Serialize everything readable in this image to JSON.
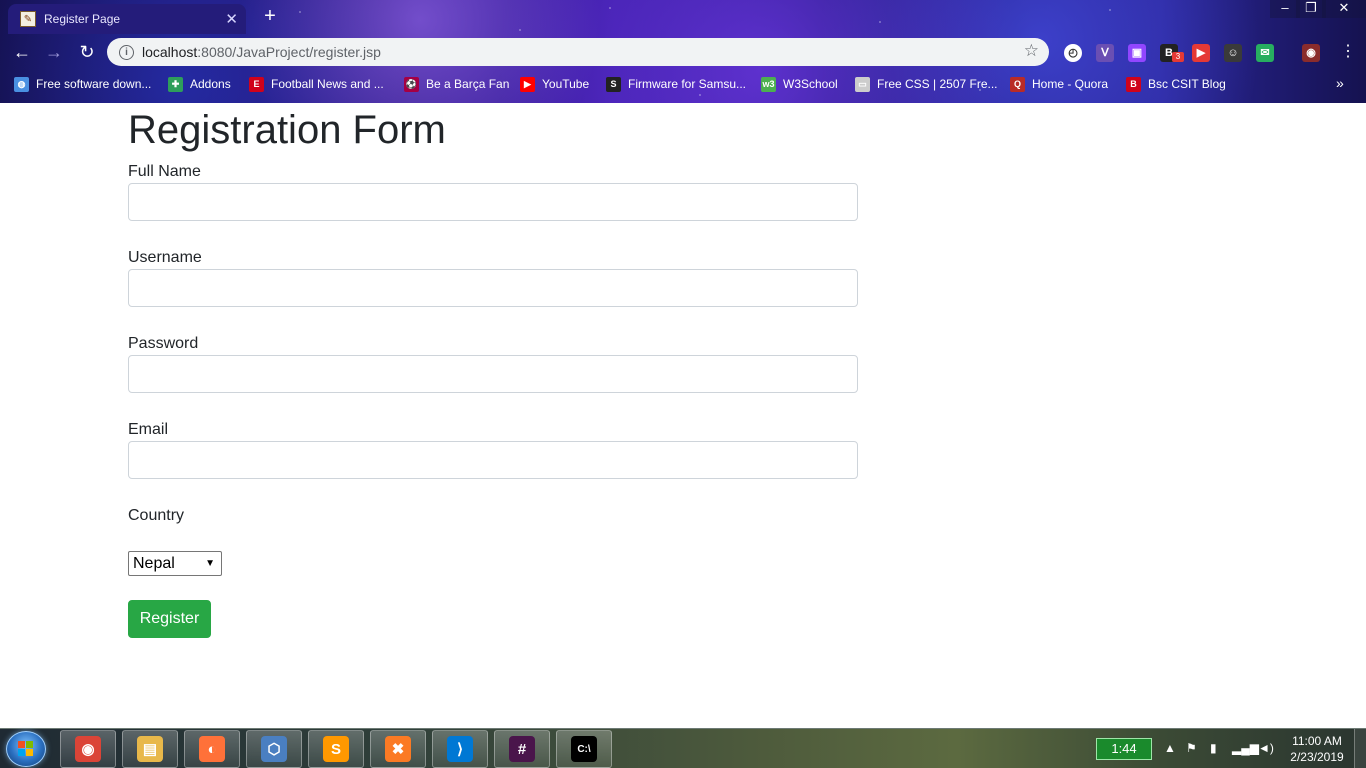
{
  "browser": {
    "tab_title": "Register Page",
    "tab_close": "✕",
    "new_tab": "+",
    "url_host": "localhost",
    "url_rest": ":8080/JavaProject/register.jsp",
    "window_controls": {
      "minimize": "–",
      "maximize": "❐",
      "close": "✕"
    },
    "extensions": [
      {
        "name": "speedometer-icon",
        "color": "#ffffff",
        "glyph": "◴"
      },
      {
        "name": "vs-extension-icon",
        "color": "#6a4fb3",
        "glyph": "ᐯ"
      },
      {
        "name": "twitch-icon",
        "color": "#9146ff",
        "glyph": "▣"
      },
      {
        "name": "b-extension-icon",
        "color": "#222222",
        "glyph": "B"
      },
      {
        "name": "play-extension-icon",
        "color": "#e53935",
        "glyph": "▶"
      },
      {
        "name": "profile-extension-icon",
        "color": "#3a3a3a",
        "glyph": "☺"
      },
      {
        "name": "chat-extension-icon",
        "color": "#27ae60",
        "glyph": "✉"
      },
      {
        "name": "user-avatar-icon",
        "color": "#8a2c2c",
        "glyph": "◉"
      }
    ],
    "extension_badge": "3",
    "bookmarks": [
      {
        "label": "Free software down...",
        "icon": "globe-icon",
        "color": "#4a90e2",
        "glyph": "◍"
      },
      {
        "label": "Addons",
        "icon": "puzzle-icon",
        "color": "#2e9e5b",
        "glyph": "✚"
      },
      {
        "label": "Football News and ...",
        "icon": "espn-icon",
        "color": "#d0021b",
        "glyph": "E"
      },
      {
        "label": "Be a Barça Fan",
        "icon": "barca-icon",
        "color": "#a50044",
        "glyph": "⚽"
      },
      {
        "label": "YouTube",
        "icon": "youtube-icon",
        "color": "#ff0000",
        "glyph": "▶"
      },
      {
        "label": "Firmware for Samsu...",
        "icon": "s-icon",
        "color": "#222222",
        "glyph": "S"
      },
      {
        "label": "W3School",
        "icon": "w3school-icon",
        "color": "#4caf50",
        "glyph": "w3"
      },
      {
        "label": "Free CSS | 2507 Fre...",
        "icon": "css-icon",
        "color": "#cccccc",
        "glyph": "▭"
      },
      {
        "label": "Home - Quora",
        "icon": "quora-icon",
        "color": "#b92b27",
        "glyph": "Q"
      },
      {
        "label": "Bsc CSIT Blog",
        "icon": "blog-icon",
        "color": "#d0021b",
        "glyph": "B"
      }
    ],
    "bookmarks_more": "»"
  },
  "form": {
    "title": "Registration Form",
    "fields": [
      {
        "label": "Full Name",
        "value": ""
      },
      {
        "label": "Username",
        "value": ""
      },
      {
        "label": "Password",
        "value": ""
      },
      {
        "label": "Email",
        "value": ""
      }
    ],
    "country_label": "Country",
    "country_selected": "Nepal",
    "submit_label": "Register"
  },
  "taskbar": {
    "apps": [
      {
        "name": "chrome-icon",
        "color": "#db4437",
        "glyph": "◉"
      },
      {
        "name": "file-explorer-icon",
        "color": "#e8b84a",
        "glyph": "▤"
      },
      {
        "name": "firefox-icon",
        "color": "#ff7139",
        "glyph": "◐"
      },
      {
        "name": "virtualbox-icon",
        "color": "#4a7fc1",
        "glyph": "⬡"
      },
      {
        "name": "sublime-text-icon",
        "color": "#ff9800",
        "glyph": "S"
      },
      {
        "name": "xampp-icon",
        "color": "#fb7a24",
        "glyph": "✖"
      },
      {
        "name": "vscode-icon",
        "color": "#0078d4",
        "glyph": "⟩"
      },
      {
        "name": "slack-icon",
        "color": "#4a154b",
        "glyph": "#"
      },
      {
        "name": "cmd-icon",
        "color": "#000000",
        "glyph": "C:\\"
      }
    ],
    "battery_time": "1:44",
    "clock_time": "11:00 AM",
    "clock_date": "2/23/2019"
  }
}
